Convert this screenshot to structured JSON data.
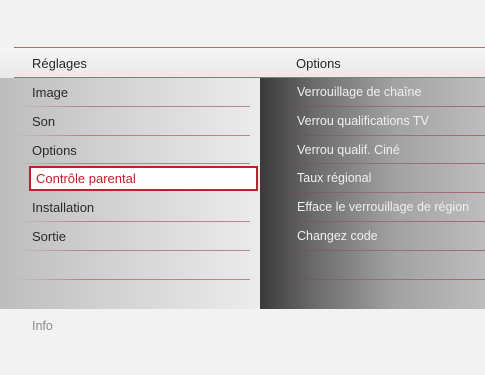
{
  "header": {
    "left_title": "Réglages",
    "right_title": "Options"
  },
  "menu": {
    "items": [
      {
        "label": "Image"
      },
      {
        "label": "Son"
      },
      {
        "label": "Options"
      },
      {
        "label": "Contrôle parental",
        "selected": true
      },
      {
        "label": "Installation"
      },
      {
        "label": "Sortie"
      },
      {
        "label": ""
      },
      {
        "label": ""
      }
    ]
  },
  "options": {
    "items": [
      {
        "label": "Verrouillage de chaîne"
      },
      {
        "label": "Verrou qualifications TV"
      },
      {
        "label": "Verrou qualif. Ciné"
      },
      {
        "label": "Taux régional"
      },
      {
        "label": "Efface le verrouillage de région"
      },
      {
        "label": "Changez code"
      },
      {
        "label": ""
      },
      {
        "label": ""
      }
    ]
  },
  "footer": {
    "info_label": "Info"
  },
  "colors": {
    "accent": "#b8232f",
    "selected_text": "#c0202d",
    "separator": "#b46a73"
  }
}
